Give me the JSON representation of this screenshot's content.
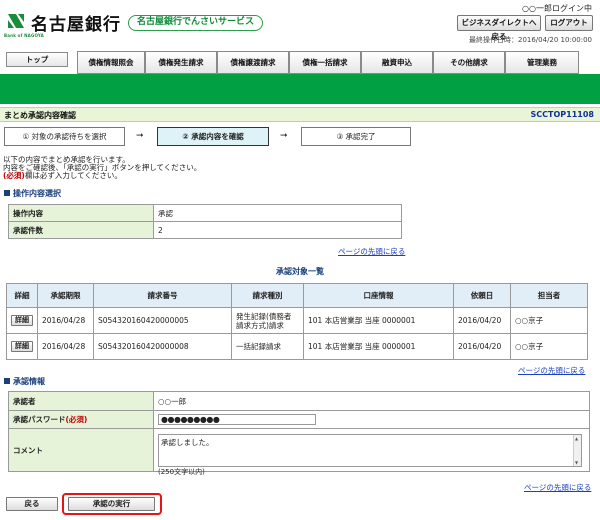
{
  "header": {
    "bank_name": "名古屋銀行",
    "bank_sub": "Bank of NAGOYA",
    "service_name": "名古屋銀行でんさいサービス",
    "user_login": "○○一郎ログイン中",
    "biz_direct_label": "ビジネスダイレクトへ戻る",
    "logout_label": "ログアウト",
    "last_operation": "最終操作日時：2016/04/20 10:00:00"
  },
  "nav": {
    "top_label": "トップ",
    "tabs": [
      "債権情報照会",
      "債権発生請求",
      "債権譲渡請求",
      "債権一括請求",
      "融資申込",
      "その他請求",
      "管理業務"
    ]
  },
  "page": {
    "title": "まとめ承認内容確認",
    "screen_id": "SCCTOP11108"
  },
  "steps": [
    "① 対象の承認待ちを選択",
    "② 承認内容を確認",
    "③ 承認完了"
  ],
  "instructions": {
    "line1": "以下の内容でまとめ承認を行います。",
    "line2": "内容をご確認後、「承認の実行」ボタンを押してください。",
    "required_mark": "(必須)",
    "line3_rest": "欄は必ず入力してください。"
  },
  "operation": {
    "heading": "操作内容選択",
    "content_label": "操作内容",
    "content_value": "承認",
    "count_label": "承認件数",
    "count_value": "2"
  },
  "link_top": "ページの先頭に戻る",
  "list": {
    "title": "承認対象一覧",
    "headers": [
      "詳細",
      "承認期限",
      "請求番号",
      "請求種別",
      "口座情報",
      "依頼日",
      "担当者"
    ],
    "detail_button": "詳細",
    "rows": [
      {
        "deadline": "2016/04/28",
        "request_no": "S054320160420000005",
        "type_line1": "発生記録(債務者",
        "type_line2": "請求方式)請求",
        "account": "101 本店営業部 当座 0000001",
        "request_date": "2016/04/20",
        "person": "○○京子"
      },
      {
        "deadline": "2016/04/28",
        "request_no": "S054320160420000008",
        "type_line1": "一括記録請求",
        "type_line2": "",
        "account": "101 本店営業部 当座 0000001",
        "request_date": "2016/04/20",
        "person": "○○京子"
      }
    ]
  },
  "approval": {
    "heading": "承認情報",
    "approver_label": "承認者",
    "approver_value": "○○一郎",
    "password_label": "承認パスワード",
    "password_required": "(必須)",
    "password_mask": "●●●●●●●●●",
    "comment_label": "コメント",
    "comment_value": "承認しました。",
    "comment_limit": "(250文字以内)"
  },
  "buttons": {
    "back": "戻る",
    "execute": "承認の実行"
  },
  "colors": {
    "brand_green": "#00a043",
    "title_bar_bg": "#e9f5d6",
    "label_bg": "#e6f3d9",
    "header_bg": "#e2eef7",
    "link_blue": "#1a40c0",
    "required_red": "#c00000",
    "highlight_red": "#e81414"
  }
}
